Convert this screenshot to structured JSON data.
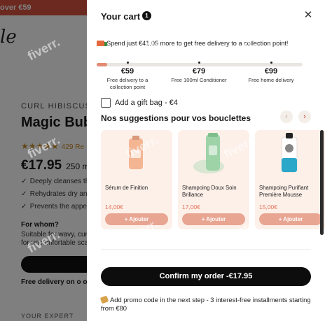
{
  "background_page": {
    "promo_bar": "over €59",
    "logo": "le",
    "brand": "CURL HIBISCUS",
    "title": "Magic Bub",
    "rating_stars": "★★★★★",
    "reviews": "429 Re",
    "price": "€17.95",
    "size": "250 ml",
    "benefits": [
      "Deeply cleanses th",
      "Rehydrates dry and",
      "Prevents the appea"
    ],
    "for_whom_heading": "For whom?",
    "for_whom_text": "Suitable for wavy, curl for uncomfortable sca",
    "delivery": "Free delivery on o over €59",
    "expert": "YOUR EXPERT"
  },
  "cart": {
    "title": "Your cart",
    "count": "1",
    "close_icon": "close-icon",
    "shipping_message": "Spend just €41.05 more to get free delivery to a collection point!",
    "progress_percent": 5,
    "milestones": [
      {
        "amount": "€59",
        "reward": "Free delivery to a collection point"
      },
      {
        "amount": "€79",
        "reward": "Free 100ml Conditioner"
      },
      {
        "amount": "€99",
        "reward": "Free home delivery"
      }
    ],
    "gift_bag_label": "Add a gift bag - €4",
    "suggestions_title": "Nos suggestions pour vos bouclettes",
    "products": [
      {
        "name": "Sérum de Finition",
        "price": "14,00€",
        "button": "+ Ajouter",
        "tube_color": "#f3b592"
      },
      {
        "name": "Shampoing Doux Soin Brillance",
        "price": "17,00€",
        "button": "+ Ajouter",
        "tube_color": "#9ed3a8"
      },
      {
        "name": "Shampoing Purifiant Première Mousse",
        "price": "15,00€",
        "button": "+ Ajouter",
        "tube_color": "#2ba7c9"
      }
    ],
    "confirm_label": "Confirm my order -€17.95",
    "promo_line": "Add promo code in the next step - 3 interest-free installments starting from €80"
  },
  "watermark": "fiverr.",
  "colors": {
    "accent": "#e38a72",
    "button": "#e8a592",
    "price": "#e07155",
    "card_bg": "#fdf0e9",
    "promo_bar": "#d9533f",
    "confirm": "#0d0d0d"
  }
}
